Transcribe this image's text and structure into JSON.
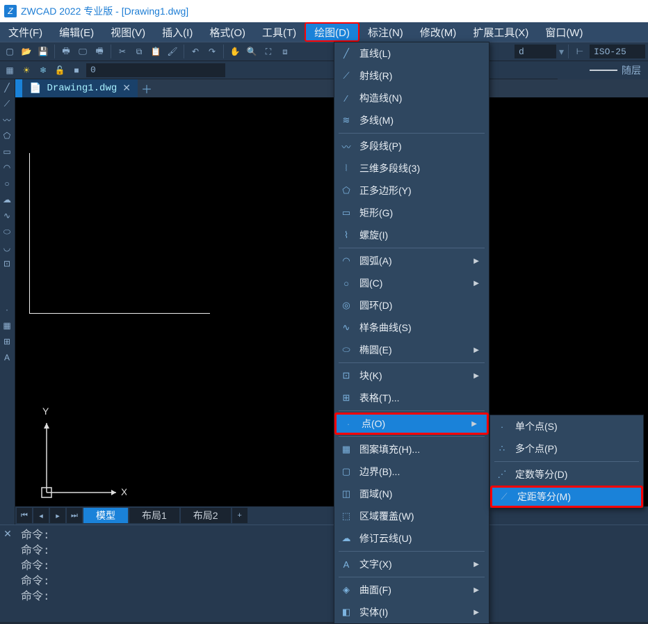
{
  "title": "ZWCAD 2022 专业版 - [Drawing1.dwg]",
  "menubar": [
    "文件(F)",
    "编辑(E)",
    "视图(V)",
    "插入(I)",
    "格式(O)",
    "工具(T)",
    "绘图(D)",
    "标注(N)",
    "修改(M)",
    "扩展工具(X)",
    "窗口(W)"
  ],
  "active_menu_index": 6,
  "doctab": "Drawing1.dwg",
  "layer_value": "0",
  "dimstyle_value": "ISO-25",
  "layer_combo": "随层",
  "linetype_combo_label": "d",
  "model_tabs": [
    "模型",
    "布局1",
    "布局2"
  ],
  "active_model_tab": 0,
  "cmd_prompt": "命令:",
  "draw_menu": [
    {
      "icon": "line",
      "label": "直线(L)"
    },
    {
      "icon": "ray",
      "label": "射线(R)"
    },
    {
      "icon": "xline",
      "label": "构造线(N)"
    },
    {
      "icon": "mline",
      "label": "多线(M)"
    },
    {
      "sep": true
    },
    {
      "icon": "pline",
      "label": "多段线(P)"
    },
    {
      "icon": "3dpoly",
      "label": "三维多段线(3)"
    },
    {
      "icon": "polygon",
      "label": "正多边形(Y)"
    },
    {
      "icon": "rect",
      "label": "矩形(G)"
    },
    {
      "icon": "spiral",
      "label": "螺旋(I)"
    },
    {
      "sep": true
    },
    {
      "icon": "arc",
      "label": "圆弧(A)",
      "sub": true
    },
    {
      "icon": "circle",
      "label": "圆(C)",
      "sub": true
    },
    {
      "icon": "donut",
      "label": "圆环(D)"
    },
    {
      "icon": "spline",
      "label": "样条曲线(S)"
    },
    {
      "icon": "ellipse",
      "label": "椭圆(E)",
      "sub": true
    },
    {
      "sep": true
    },
    {
      "icon": "block",
      "label": "块(K)",
      "sub": true
    },
    {
      "icon": "table",
      "label": "表格(T)..."
    },
    {
      "sep": true
    },
    {
      "icon": "point",
      "label": "点(O)",
      "sub": true,
      "highlight": "red"
    },
    {
      "sep": true
    },
    {
      "icon": "hatch",
      "label": "图案填充(H)..."
    },
    {
      "icon": "boundary",
      "label": "边界(B)..."
    },
    {
      "icon": "region",
      "label": "面域(N)"
    },
    {
      "icon": "wipeout",
      "label": "区域覆盖(W)"
    },
    {
      "icon": "revcloud",
      "label": "修订云线(U)"
    },
    {
      "sep": true
    },
    {
      "icon": "text",
      "label": "文字(X)",
      "sub": true
    },
    {
      "sep": true
    },
    {
      "icon": "surface",
      "label": "曲面(F)",
      "sub": true
    },
    {
      "icon": "solid",
      "label": "实体(I)",
      "sub": true
    }
  ],
  "point_submenu": [
    {
      "icon": "pt",
      "label": "单个点(S)"
    },
    {
      "icon": "pts",
      "label": "多个点(P)"
    },
    {
      "sep": true
    },
    {
      "icon": "divide",
      "label": "定数等分(D)"
    },
    {
      "icon": "measure",
      "label": "定距等分(M)",
      "highlight": "red"
    }
  ],
  "ucs": {
    "x": "X",
    "y": "Y"
  }
}
